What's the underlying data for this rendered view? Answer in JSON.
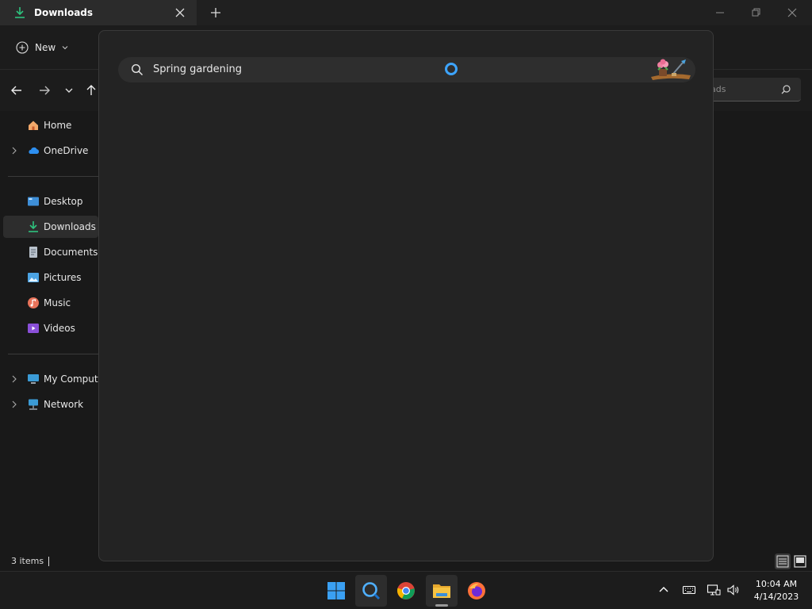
{
  "window": {
    "tab_title": "Downloads",
    "new_button": "New"
  },
  "address": {
    "search_placeholder_visible": "ads"
  },
  "sidebar": {
    "items": [
      {
        "label": "Home",
        "icon": "home-icon"
      },
      {
        "label": "OneDrive",
        "icon": "onedrive-icon"
      },
      {
        "label": "Desktop",
        "icon": "desktop-icon"
      },
      {
        "label": "Downloads",
        "icon": "downloads-icon"
      },
      {
        "label": "Documents",
        "icon": "documents-icon"
      },
      {
        "label": "Pictures",
        "icon": "pictures-icon"
      },
      {
        "label": "Music",
        "icon": "music-icon"
      },
      {
        "label": "Videos",
        "icon": "videos-icon"
      },
      {
        "label": "My Compute",
        "icon": "computer-icon"
      },
      {
        "label": "Network",
        "icon": "network-icon"
      }
    ]
  },
  "status": {
    "item_count": "3 items"
  },
  "search": {
    "query": "Spring gardening"
  },
  "taskbar": {
    "time": "10:04 AM",
    "date": "4/14/2023"
  },
  "colors": {
    "accent": "#60cdff",
    "downloads_green": "#2ec27e",
    "folder_yellow": "#f6c343"
  }
}
